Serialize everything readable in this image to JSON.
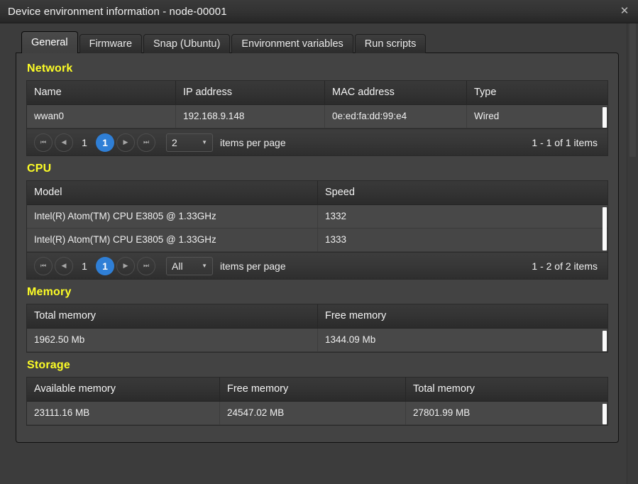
{
  "window": {
    "title": "Device environment information - node-00001",
    "close_icon": "close-icon"
  },
  "tabs": [
    {
      "label": "General",
      "active": true
    },
    {
      "label": "Firmware",
      "active": false
    },
    {
      "label": "Snap (Ubuntu)",
      "active": false
    },
    {
      "label": "Environment variables",
      "active": false
    },
    {
      "label": "Run scripts",
      "active": false
    }
  ],
  "sections": {
    "network": {
      "title": "Network",
      "columns": [
        "Name",
        "IP address",
        "MAC address",
        "Type"
      ],
      "rows": [
        [
          "wwan0",
          "192.168.9.148",
          "0e:ed:fa:dd:99:e4",
          "Wired"
        ]
      ],
      "pager": {
        "first_icon": "first-page-icon",
        "prev_icon": "previous-page-icon",
        "next_icon": "next-page-icon",
        "last_icon": "last-page-icon",
        "page_plain": "1",
        "page_current": "1",
        "page_size": "2",
        "page_size_label": "items per page",
        "count": "1 - 1 of 1 items"
      }
    },
    "cpu": {
      "title": "CPU",
      "columns": [
        "Model",
        "Speed"
      ],
      "rows": [
        [
          "Intel(R) Atom(TM) CPU E3805 @ 1.33GHz",
          "1332"
        ],
        [
          "Intel(R) Atom(TM) CPU E3805 @ 1.33GHz",
          "1333"
        ]
      ],
      "pager": {
        "first_icon": "first-page-icon",
        "prev_icon": "previous-page-icon",
        "next_icon": "next-page-icon",
        "last_icon": "last-page-icon",
        "page_plain": "1",
        "page_current": "1",
        "page_size": "All",
        "page_size_label": "items per page",
        "count": "1 - 2 of 2 items"
      }
    },
    "memory": {
      "title": "Memory",
      "columns": [
        "Total memory",
        "Free memory"
      ],
      "rows": [
        [
          "1962.50 Mb",
          "1344.09 Mb"
        ]
      ]
    },
    "storage": {
      "title": "Storage",
      "columns": [
        "Available memory",
        "Free memory",
        "Total memory"
      ],
      "rows": [
        [
          "23111.16 MB",
          "24547.02 MB",
          "27801.99 MB"
        ]
      ]
    }
  },
  "colors": {
    "accent": "#2f7fd6",
    "heading": "#fdfd26",
    "panel": "#434343",
    "window": "#3c3c3c"
  }
}
